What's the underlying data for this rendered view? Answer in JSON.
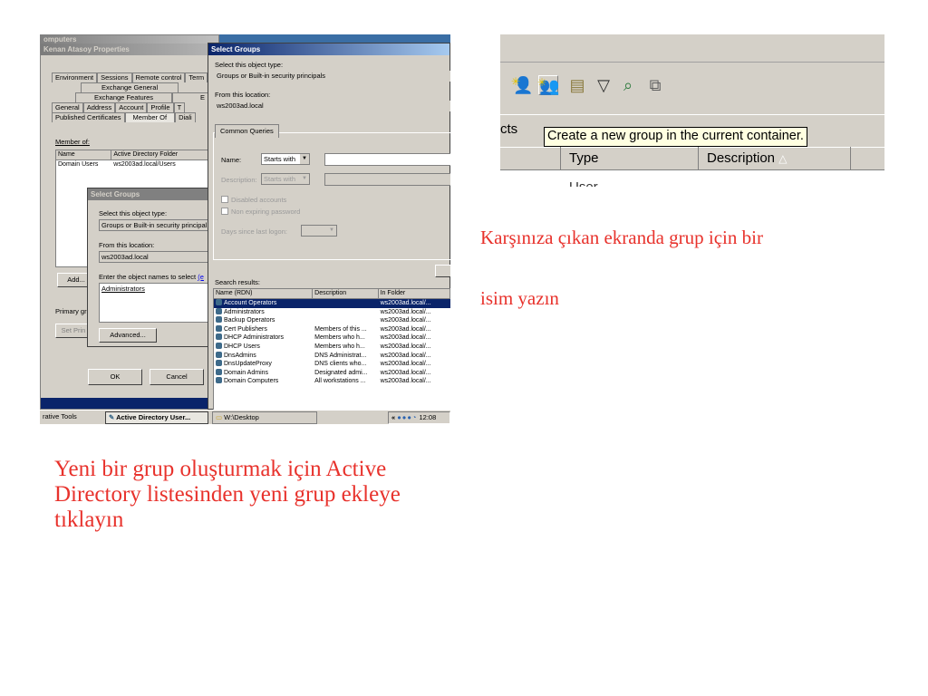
{
  "screenshot_left": {
    "properties_window": {
      "computers_crumb": "omputers",
      "title": "Kenan Atasoy Properties",
      "tabs_row1": [
        "Environment",
        "Sessions",
        "Remote control",
        "Term"
      ],
      "tabs_row2": [
        "Exchange General"
      ],
      "tabs_row3": [
        "Exchange Features",
        "E"
      ],
      "tabs_row4": [
        "General",
        "Address",
        "Account",
        "Profile",
        "T"
      ],
      "tabs_row5": [
        "Published Certificates",
        "Member Of",
        "Diali"
      ],
      "member_of_label": "Member of:",
      "columns": [
        "Name",
        "Active Directory Folder"
      ],
      "rows": [
        [
          "Domain Users",
          "ws2003ad.local/Users"
        ]
      ],
      "add_button": "Add...",
      "primary_group_label": "Primary gro",
      "set_primary_button": "Set Prin",
      "ok_button": "OK",
      "cancel_button": "Cancel"
    },
    "small_select_groups": {
      "title": "Select Groups",
      "object_type_label": "Select this object type:",
      "object_type_value": "Groups or Built-in security principal",
      "location_label": "From this location:",
      "location_value": "ws2003ad.local",
      "enter_names_label": "Enter the object names to select",
      "enter_names_link": "(e",
      "names_value": "Administrators",
      "advanced_button": "Advanced..."
    },
    "large_select_groups": {
      "title": "Select Groups",
      "object_type_label": "Select this object type:",
      "object_type_value": "Groups or Built-in security principals",
      "location_label": "From this location:",
      "location_value": "ws2003ad.local",
      "common_queries_tab": "Common Queries",
      "name_label": "Name:",
      "name_operator": "Starts with",
      "description_label": "Description:",
      "description_operator": "Starts with",
      "disabled_accounts": "Disabled accounts",
      "non_expiring_password": "Non expiring password",
      "days_since_logon": "Days since last logon:",
      "search_results_label": "Search results:",
      "columns": [
        "Name (RDN)",
        "Description",
        "In Folder"
      ],
      "rows": [
        [
          "Account Operators",
          "",
          "ws2003ad.local/..."
        ],
        [
          "Administrators",
          "",
          "ws2003ad.local/..."
        ],
        [
          "Backup Operators",
          "",
          "ws2003ad.local/..."
        ],
        [
          "Cert Publishers",
          "Members of this ...",
          "ws2003ad.local/..."
        ],
        [
          "DHCP Administrators",
          "Members who h...",
          "ws2003ad.local/..."
        ],
        [
          "DHCP Users",
          "Members who h...",
          "ws2003ad.local/..."
        ],
        [
          "DnsAdmins",
          "DNS Administrat...",
          "ws2003ad.local/..."
        ],
        [
          "DnsUpdateProxy",
          "DNS clients who...",
          "ws2003ad.local/..."
        ],
        [
          "Domain Admins",
          "Designated admi...",
          "ws2003ad.local/..."
        ],
        [
          "Domain Computers",
          "All workstations ...",
          "ws2003ad.local/..."
        ]
      ],
      "selected_row": 0
    },
    "taskbar": {
      "item1": "rative Tools",
      "item2": "Active Directory User...",
      "item3": "W:\\Desktop",
      "tray_arrows": "«",
      "clock": "12:08"
    }
  },
  "screenshot_right": {
    "partial_label": "cts",
    "tooltip": "Create a new group in the current container.",
    "column_type": "Type",
    "column_description": "Description",
    "sort_indicator": "△",
    "partial_row": "User",
    "toolbar_icons": [
      "new-user-icon",
      "new-group-icon",
      "new-ou-icon",
      "filter-icon",
      "find-icon",
      "add-to-group-icon"
    ]
  },
  "captions": {
    "right_line1": "Karşınıza çıkan ekranda grup için bir",
    "right_line2": "isim yazın",
    "bottom": "Yeni bir grup oluşturmak için Active Directory listesinden yeni grup ekleye tıklayın"
  },
  "colors": {
    "caption": "#e8322c",
    "titlebar": "#0a246a",
    "selection": "#0a246a",
    "tooltip_bg": "#ffffe1"
  }
}
